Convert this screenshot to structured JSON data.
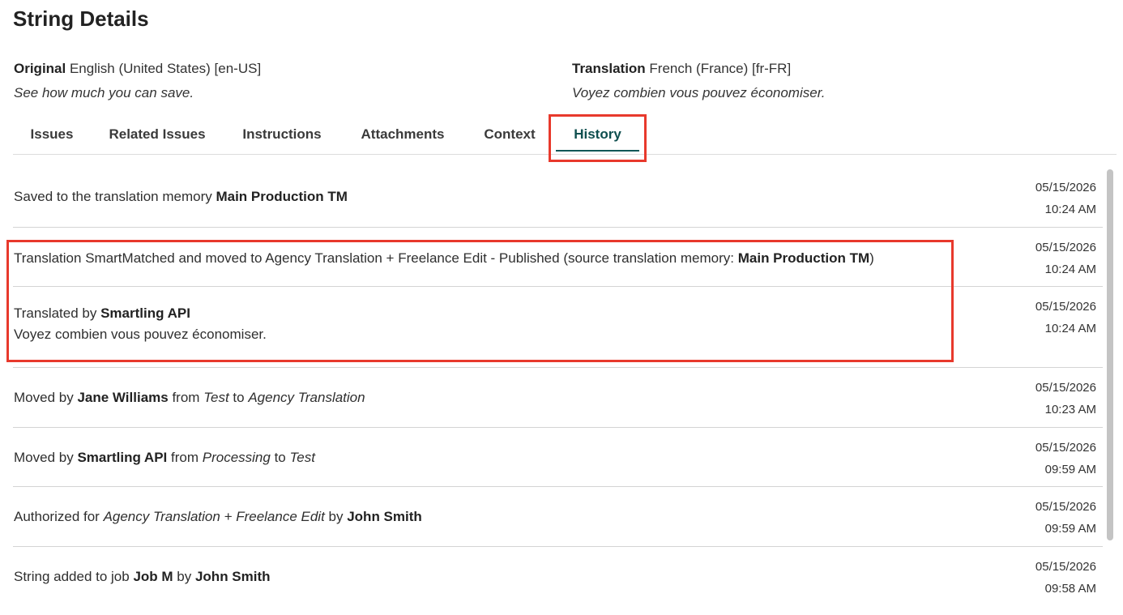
{
  "page_title": "String Details",
  "original": {
    "label": "Original",
    "language": "English (United States) [en-US]",
    "text": "See how much you can save."
  },
  "translation": {
    "label": "Translation",
    "language": "French (France) [fr-FR]",
    "text": "Voyez combien vous pouvez économiser."
  },
  "tabs": [
    {
      "label": "Issues"
    },
    {
      "label": "Related Issues"
    },
    {
      "label": "Instructions"
    },
    {
      "label": "Attachments"
    },
    {
      "label": "Context"
    },
    {
      "label": "History",
      "active": true
    }
  ],
  "history": [
    {
      "parts": [
        {
          "t": "Saved to the translation memory "
        },
        {
          "t": "Main Production TM",
          "b": true
        }
      ],
      "date": "05/15/2026",
      "time": "10:24 AM"
    },
    {
      "parts": [
        {
          "t": "Translation SmartMatched and moved to Agency Translation + Freelance Edit - Published (source translation memory: "
        },
        {
          "t": "Main Production TM",
          "b": true
        },
        {
          "t": ")"
        }
      ],
      "date": "05/15/2026",
      "time": "10:24 AM"
    },
    {
      "parts": [
        {
          "t": "Translated by "
        },
        {
          "t": "Smartling API",
          "b": true
        }
      ],
      "detail": "Voyez combien vous pouvez économiser.",
      "date": "05/15/2026",
      "time": "10:24 AM"
    },
    {
      "parts": [
        {
          "t": "Moved by "
        },
        {
          "t": "Jane Williams",
          "b": true
        },
        {
          "t": " from "
        },
        {
          "t": "Test",
          "i": true
        },
        {
          "t": " to "
        },
        {
          "t": "Agency Translation",
          "i": true
        }
      ],
      "date": "05/15/2026",
      "time": "10:23 AM"
    },
    {
      "parts": [
        {
          "t": "Moved by "
        },
        {
          "t": "Smartling API",
          "b": true
        },
        {
          "t": " from "
        },
        {
          "t": "Processing",
          "i": true
        },
        {
          "t": " to "
        },
        {
          "t": "Test",
          "i": true
        }
      ],
      "date": "05/15/2026",
      "time": "09:59 AM"
    },
    {
      "parts": [
        {
          "t": "Authorized for "
        },
        {
          "t": "Agency Translation + Freelance Edit",
          "i": true
        },
        {
          "t": " by "
        },
        {
          "t": "John Smith",
          "b": true
        }
      ],
      "date": "05/15/2026",
      "time": "09:59 AM"
    },
    {
      "parts": [
        {
          "t": "String added to job "
        },
        {
          "t": "Job M",
          "b": true
        },
        {
          "t": " by "
        },
        {
          "t": "John Smith",
          "b": true
        }
      ],
      "date": "05/15/2026",
      "time": "09:58 AM"
    }
  ],
  "colors": {
    "accent": "#0f5757",
    "highlight": "#e8392c"
  }
}
